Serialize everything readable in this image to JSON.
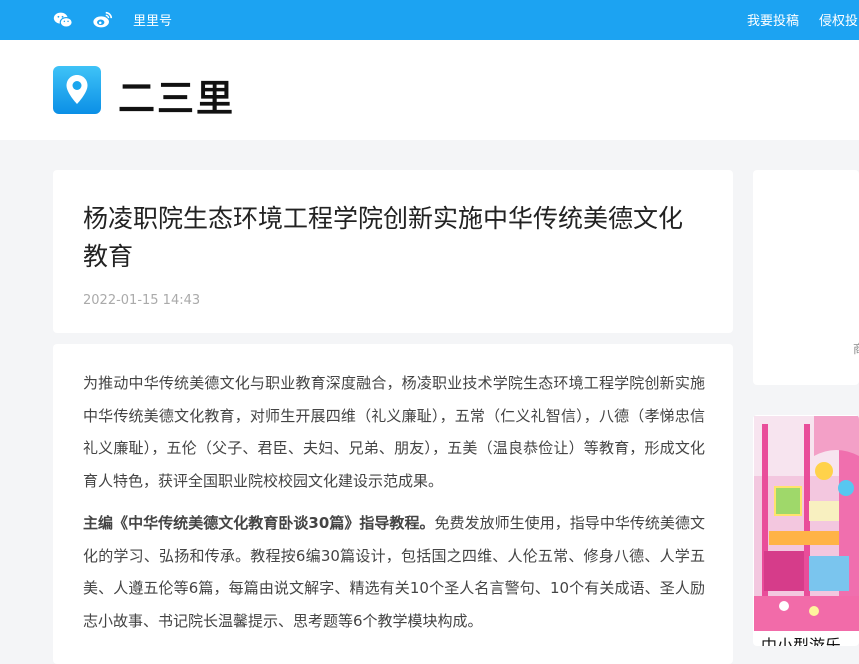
{
  "topbar": {
    "icons": [
      "wechat-icon",
      "weibo-icon"
    ],
    "brand_link": "里里号",
    "submit_link": "我要投稿",
    "report_link": "侵权投"
  },
  "header": {
    "site_name": "二三里",
    "logo_icon": "location-pin-icon"
  },
  "article": {
    "title": "杨凌职院生态环境工程学院创新实施中华传统美德文化教育",
    "date": "2022-01-15 14:43",
    "p1": "为推动中华传统美德文化与职业教育深度融合，杨凌职业技术学院生态环境工程学院创新实施中华传统美德文化教育，对师生开展四维（礼义廉耻），五常（仁义礼智信），八德（孝悌忠信礼义廉耻），五伦（父子、君臣、夫妇、兄弟、朋友），五美（温良恭俭让）等教育，形成文化育人特色，获评全国职业院校校园文化建设示范成果。",
    "p2_bold": "主编《中华传统美德文化教育卧谈30篇》指导教程。",
    "p2_rest": "免费发放师生使用，指导中华传统美德文化的学习、弘扬和传承。教程按6编30篇设计，包括国之四维、人伦五常、修身八德、人学五美、人遵五伦等6篇，每篇由说文解字、精选有关10个圣人名言警句、10个有关成语、圣人励志小故事、书记院长温馨提示、思考题等6个教学模块构成。"
  },
  "sidebar": {
    "fragment": "商",
    "ad_caption": "中小型游乐"
  },
  "colors": {
    "topbar": "#1ca3f2",
    "background": "#f4f5f7",
    "logo_gradient_top": "#3fc3f7",
    "logo_gradient_bottom": "#0b8fe6"
  }
}
